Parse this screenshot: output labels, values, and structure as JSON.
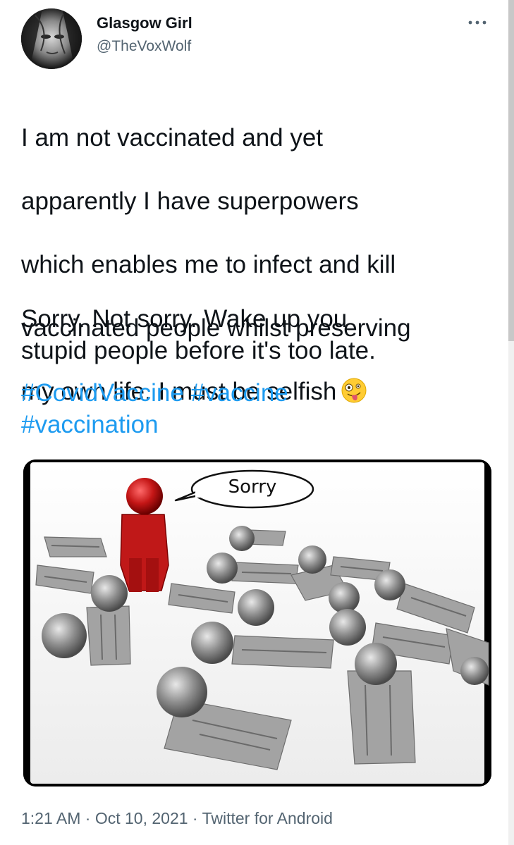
{
  "author": {
    "display_name": "Glasgow Girl",
    "handle": "@TheVoxWolf"
  },
  "tweet": {
    "text_lines": [
      "I am not vaccinated and yet",
      "apparently I have superpowers",
      "which enables me to infect and kill",
      "vaccinated people whilst preserving",
      "my own life. I must be selfish"
    ],
    "emoji": "zany-face-emoji",
    "paragraph2_lines": [
      "Sorry. Not sorry. Wake up you",
      "stupid people before it's too late."
    ],
    "hashtags": [
      "#CovidVaccine",
      "#vaccine",
      "#vaccination"
    ]
  },
  "media": {
    "speech_bubble_text": "Sorry"
  },
  "meta": {
    "time": "1:21 AM",
    "separator": " · ",
    "date": "Oct 10, 2021",
    "source": "Twitter for Android"
  },
  "colors": {
    "link": "#1d9bf0",
    "secondary_text": "#536471",
    "primary_text": "#0f1419",
    "figure_red": "#c01818",
    "figure_gray": "#9a9a9a"
  },
  "icons": {
    "more": "more-options-icon"
  }
}
